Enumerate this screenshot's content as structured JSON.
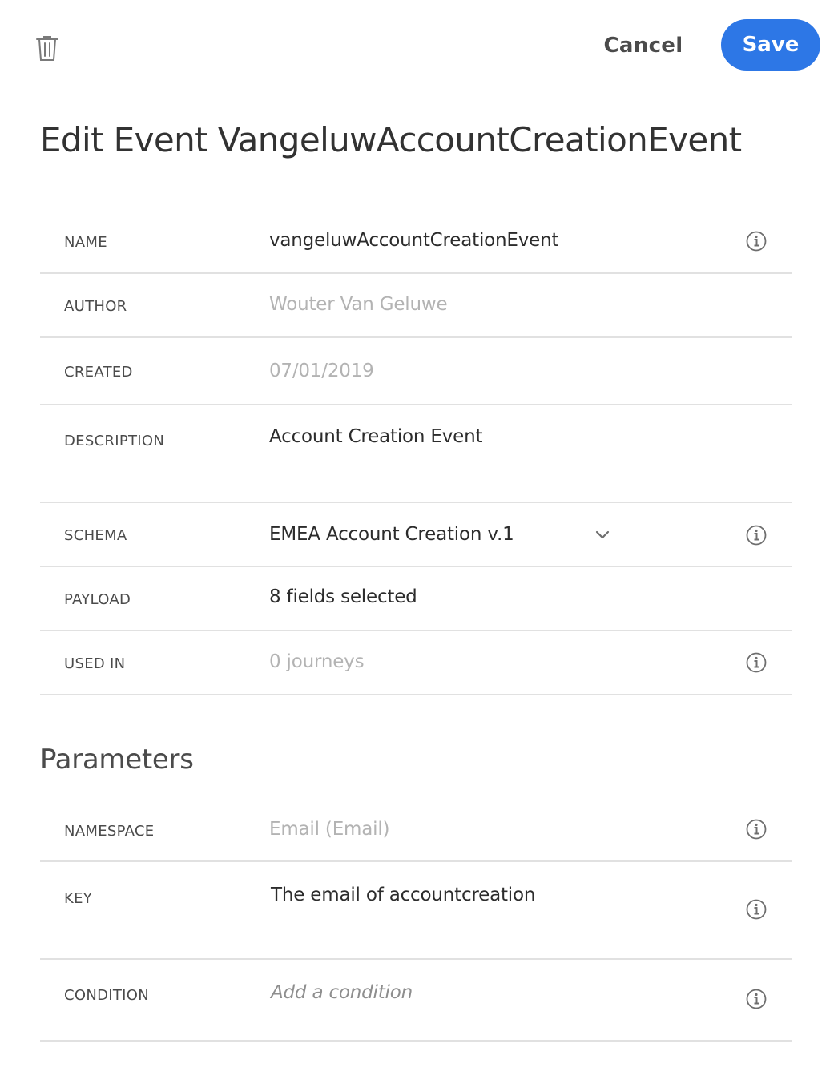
{
  "toolbar": {
    "delete_icon": "trash-icon",
    "cancel_label": "Cancel",
    "save_label": "Save",
    "accent_color": "#2d77e6"
  },
  "page_title": "Edit Event VangeluwAccountCreationEvent",
  "fields": {
    "name": {
      "label": "NAME",
      "value": "vangeluwAccountCreationEvent"
    },
    "author": {
      "label": "AUTHOR",
      "value": "Wouter Van Geluwe"
    },
    "created": {
      "label": "CREATED",
      "value": "07/01/2019"
    },
    "description": {
      "label": "DESCRIPTION",
      "value": "Account Creation Event"
    },
    "schema": {
      "label": "SCHEMA",
      "value": "EMEA Account Creation v.1"
    },
    "payload": {
      "label": "PAYLOAD",
      "value": "8 fields selected"
    },
    "used_in": {
      "label": "USED IN",
      "value": "0 journeys"
    }
  },
  "parameters": {
    "heading": "Parameters",
    "namespace": {
      "label": "NAMESPACE",
      "value": "Email (Email)"
    },
    "key": {
      "label": "KEY",
      "value": "The email of accountcreation"
    },
    "condition": {
      "label": "CONDITION",
      "placeholder": "Add a condition"
    }
  }
}
